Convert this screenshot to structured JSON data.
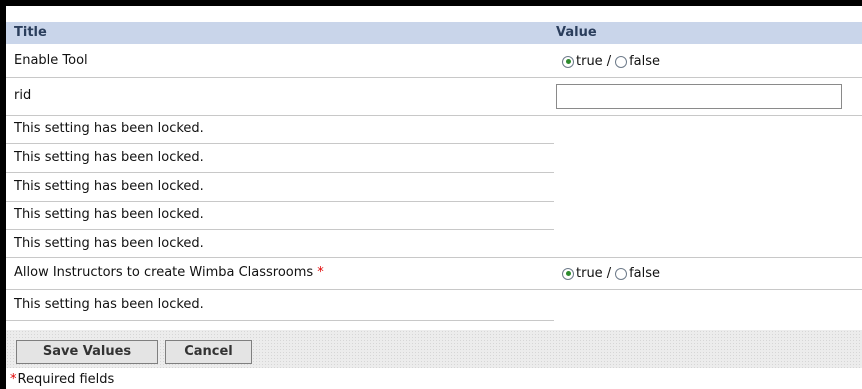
{
  "table": {
    "header_title": "Title",
    "header_value": "Value"
  },
  "rows": [
    {
      "label": "Enable Tool",
      "true_label": "true",
      "separator": "/",
      "false_label": "false",
      "selected": "true"
    },
    {
      "label": "rid",
      "input_value": ""
    },
    {
      "label": "This setting has been locked."
    },
    {
      "label": "This setting has been locked."
    },
    {
      "label": "This setting has been locked."
    },
    {
      "label": "This setting has been locked."
    },
    {
      "label": "This setting has been locked."
    },
    {
      "label": "Allow Instructors to create Wimba Classrooms",
      "required_mark": "*",
      "true_label": "true",
      "separator": "/",
      "false_label": "false",
      "selected": "true"
    },
    {
      "label": "This setting has been locked."
    }
  ],
  "buttons": {
    "save_label": "Save Values",
    "cancel_label": "Cancel"
  },
  "footer": {
    "required_mark": "*",
    "required_text": "Required fields"
  },
  "colors": {
    "header_bg": "#c9d5ea",
    "header_text": "#2b3e5c",
    "required": "#e00000",
    "radio_selected": "#2d8a2d"
  }
}
